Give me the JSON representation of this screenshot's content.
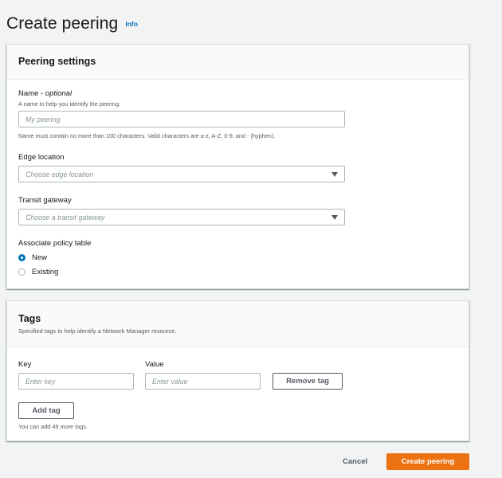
{
  "header": {
    "title": "Create peering",
    "info_link": "Info"
  },
  "peering_settings": {
    "title": "Peering settings",
    "name": {
      "label": "Name",
      "optional": "optional",
      "description": "A name to help you identify the peering.",
      "placeholder": "My peering",
      "value": "",
      "constraint": "Name must contain no more than 100 characters. Valid characters are a-z, A-Z, 0-9, and - (hyphen)."
    },
    "edge_location": {
      "label": "Edge location",
      "placeholder": "Choose edge location"
    },
    "transit_gateway": {
      "label": "Transit gateway",
      "placeholder": "Choose a transit gateway"
    },
    "policy_table": {
      "label": "Associate policy table",
      "options": [
        {
          "label": "New",
          "selected": true
        },
        {
          "label": "Existing",
          "selected": false
        }
      ]
    }
  },
  "tags": {
    "title": "Tags",
    "description": "Specified tags to help identify a Network Manager resource.",
    "key_label": "Key",
    "value_label": "Value",
    "key_placeholder": "Enter key",
    "value_placeholder": "Enter value",
    "remove_label": "Remove tag",
    "add_label": "Add tag",
    "remaining_note": "You can add 49 more tags."
  },
  "footer": {
    "cancel_label": "Cancel",
    "submit_label": "Create peering"
  },
  "colors": {
    "accent": "#0073bb",
    "primary_button": "#ec7211",
    "background": "#f2f3f3"
  }
}
